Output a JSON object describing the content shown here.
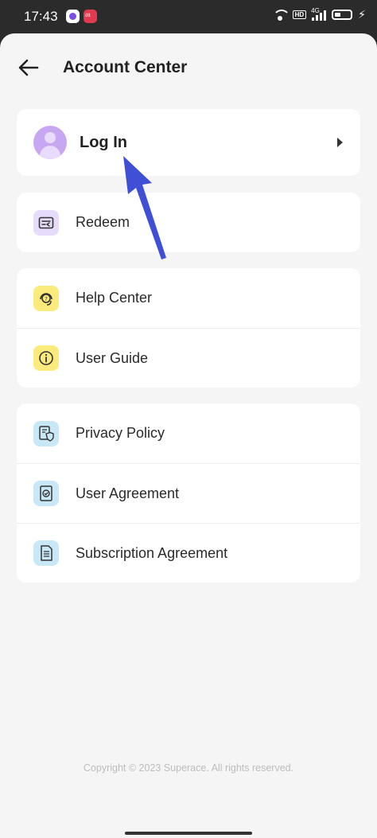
{
  "status_bar": {
    "time": "17:43",
    "hd": "HD",
    "network": "4G",
    "app_badge": "dtt"
  },
  "header": {
    "title": "Account Center",
    "back_icon": "arrow-left-icon"
  },
  "login": {
    "label": "Log In",
    "avatar_icon": "user-avatar-icon",
    "chevron_icon": "chevron-right-icon"
  },
  "menu": {
    "redeem": {
      "label": "Redeem",
      "icon": "ticket-icon",
      "color": "#e6dcf9"
    },
    "help_center": {
      "label": "Help Center",
      "icon": "headset-icon",
      "color": "#fbeb7d"
    },
    "user_guide": {
      "label": "User Guide",
      "icon": "info-icon",
      "color": "#fbeb7d"
    },
    "privacy_policy": {
      "label": "Privacy Policy",
      "icon": "shield-document-icon",
      "color": "#c9e8f7"
    },
    "user_agreement": {
      "label": "User Agreement",
      "icon": "check-document-icon",
      "color": "#c9e8f7"
    },
    "subscription_agreement": {
      "label": "Subscription Agreement",
      "icon": "document-icon",
      "color": "#c9e8f7"
    }
  },
  "annotation": {
    "arrow_color": "#3f4fd6",
    "arrow_icon": "pointer-arrow-icon"
  },
  "footer": {
    "copyright": "Copyright © 2023 Superace. All rights reserved."
  }
}
